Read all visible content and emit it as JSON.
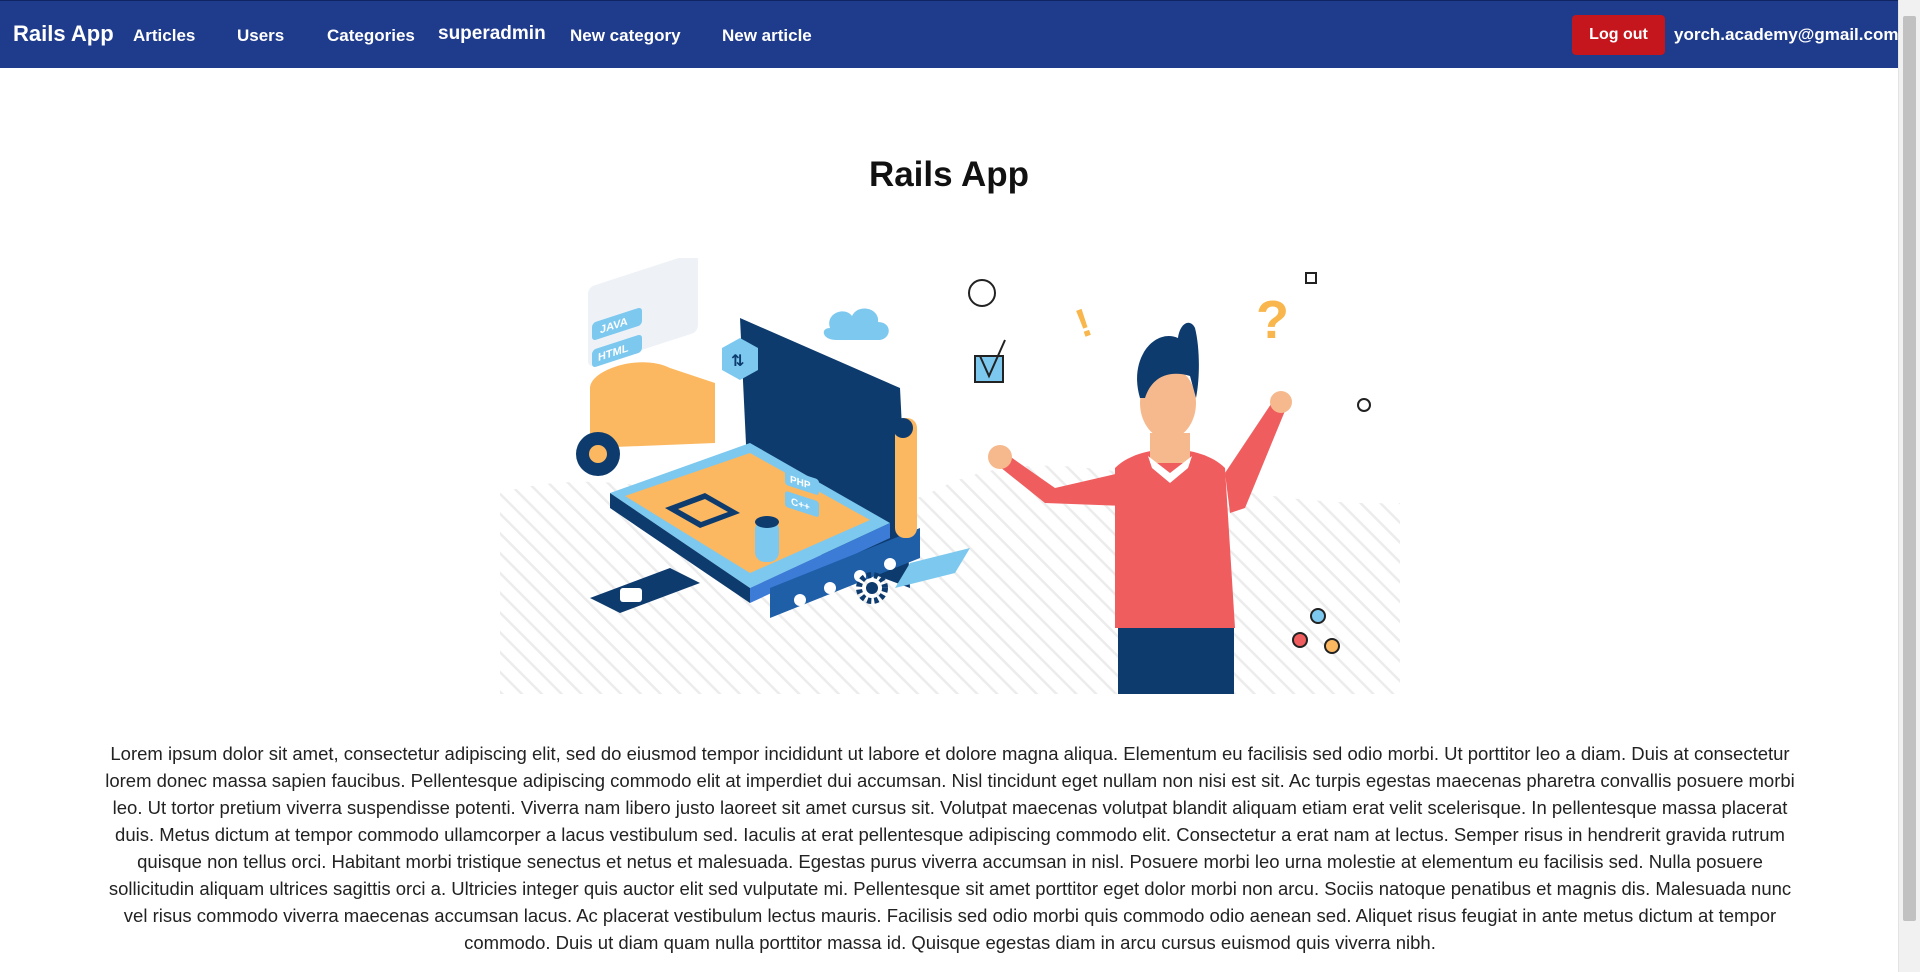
{
  "nav": {
    "brand": "Rails App",
    "links": [
      "Articles",
      "Users",
      "Categories"
    ],
    "username": "superadmin",
    "new_category": "New category",
    "new_article": "New article",
    "logout_label": "Log out",
    "email": "yorch.academy@gmail.com"
  },
  "main": {
    "title": "Rails App",
    "hero_image": {
      "labels": [
        "JAVA",
        "HTML",
        "PHP",
        "C++"
      ]
    },
    "paragraph": "Lorem ipsum dolor sit amet, consectetur adipiscing elit, sed do eiusmod tempor incididunt ut labore et dolore magna aliqua. Elementum eu facilisis sed odio morbi. Ut porttitor leo a diam. Duis at consectetur lorem donec massa sapien faucibus. Pellentesque adipiscing commodo elit at imperdiet dui accumsan. Nisl tincidunt eget nullam non nisi est sit. Ac turpis egestas maecenas pharetra convallis posuere morbi leo. Ut tortor pretium viverra suspendisse potenti. Viverra nam libero justo laoreet sit amet cursus sit. Volutpat maecenas volutpat blandit aliquam etiam erat velit scelerisque. In pellentesque massa placerat duis. Metus dictum at tempor commodo ullamcorper a lacus vestibulum sed. Iaculis at erat pellentesque adipiscing commodo elit. Consectetur a erat nam at lectus. Semper risus in hendrerit gravida rutrum quisque non tellus orci. Habitant morbi tristique senectus et netus et malesuada. Egestas purus viverra accumsan in nisl. Posuere morbi leo urna molestie at elementum eu facilisis sed. Nulla posuere sollicitudin aliquam ultrices sagittis orci a. Ultricies integer quis auctor elit sed vulputate mi. Pellentesque sit amet porttitor eget dolor morbi non arcu. Sociis natoque penatibus et magnis dis. Malesuada nunc vel risus commodo viverra maecenas accumsan lacus. Ac placerat vestibulum lectus mauris. Facilisis sed odio morbi quis commodo odio aenean sed. Aliquet risus feugiat in ante metus dictum at tempor commodo. Duis ut diam quam nulla porttitor massa id. Quisque egestas diam in arcu cursus euismod quis viverra nibh."
  },
  "colors": {
    "navbar_bg": "#1f3b8c",
    "logout_bg": "#c4161c",
    "hero_orange": "#fbb861",
    "hero_navy": "#0d3b6e",
    "hero_sky": "#7cc8ef",
    "hero_red": "#f05d5e"
  }
}
